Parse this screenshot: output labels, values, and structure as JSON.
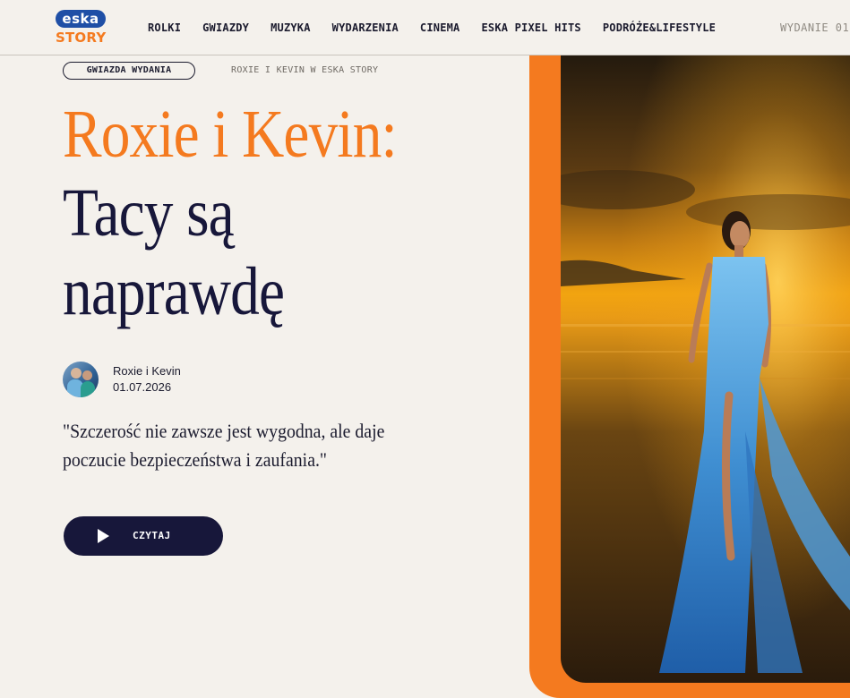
{
  "header": {
    "logo": {
      "top": "eska",
      "bottom": "STORY"
    },
    "nav": [
      "ROLKI",
      "GWIAZDY",
      "MUZYKA",
      "WYDARZENIA",
      "CINEMA",
      "ESKA PIXEL HITS",
      "PODRÓŻE&LIFESTYLE"
    ],
    "edition": "WYDANIE 01"
  },
  "hero": {
    "badge": "GWIAZDA WYDANIA",
    "breadcrumb": "ROXIE I KEVIN W ESKA STORY",
    "title_line1": "Roxie i Kevin:",
    "title_line2": "Tacy są",
    "title_line3": "naprawdę",
    "author_name": "Roxie i Kevin",
    "author_date": "01.07.2026",
    "quote": "\"Szczerość nie zawsze jest wygodna, ale daje poczucie bezpieczeństwa i zaufania.\"",
    "cta_label": "CZYTAJ"
  },
  "colors": {
    "accent": "#f47a1f",
    "navy": "#17173a",
    "background": "#f4f1ec",
    "logo_blue": "#1f4fa6"
  },
  "icons": {
    "cta": "play-icon",
    "author": "avatar"
  }
}
